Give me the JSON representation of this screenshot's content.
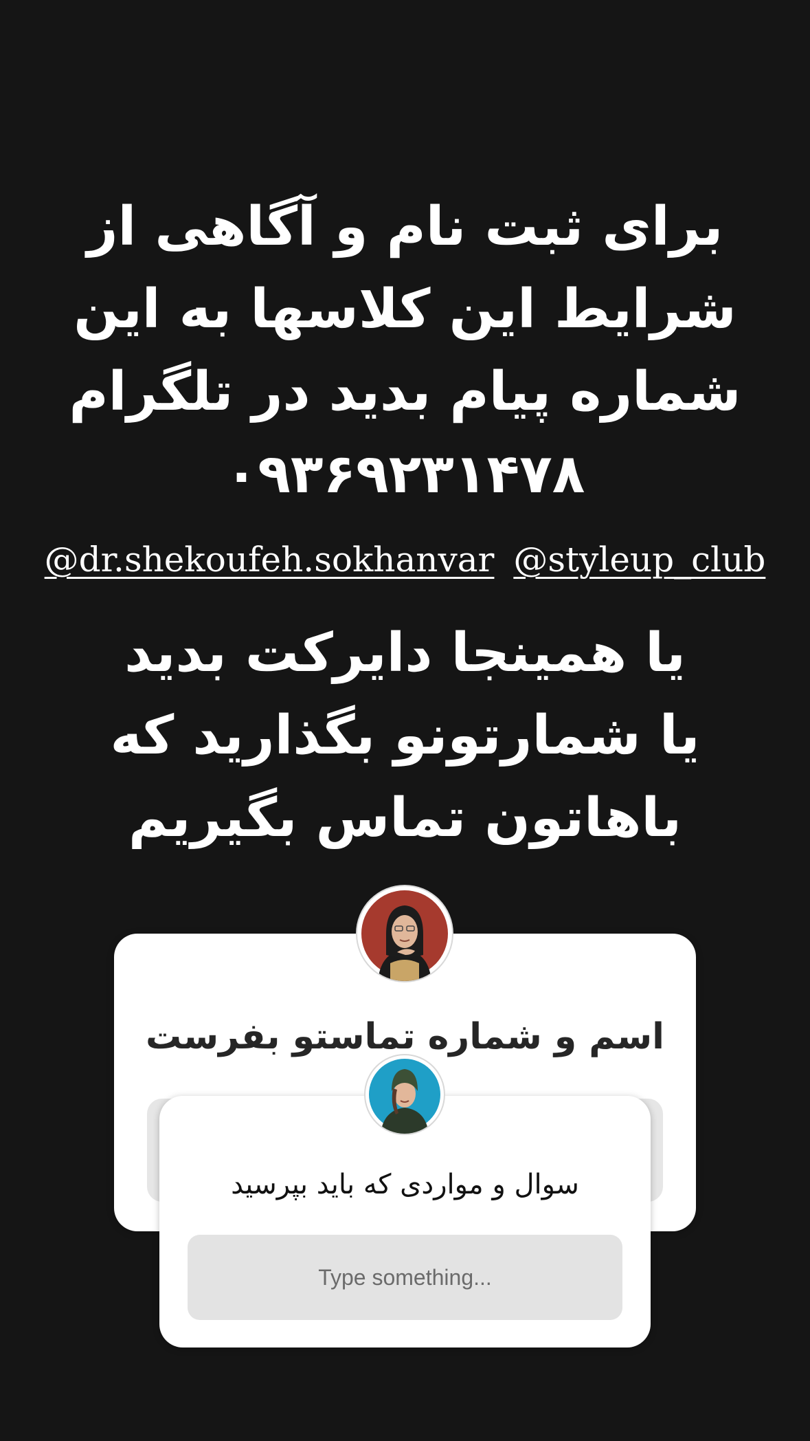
{
  "headline_top": {
    "lines": [
      "برای ثبت نام و آگاهی از",
      "شرایط این کلاسها به این",
      "شماره پیام بدید در تلگرام",
      "۰۹۳۶۹۲۳۱۴۷۸"
    ]
  },
  "mentions": {
    "first": "@dr.shekoufeh.sokhanvar",
    "second": "@styleup_club"
  },
  "headline_bottom": {
    "lines": [
      "یا همینجا دایرکت بدید",
      "یا شمارتونو بگذارید که",
      "باهاتون تماس بگیریم"
    ]
  },
  "question_sticker_back": {
    "question": "اسم و شماره تماستو بفرست",
    "avatar_icon": "profile-avatar-woman-hijab-red-background"
  },
  "question_sticker_front": {
    "question": "سوال و مواردی که باید بپرسید",
    "placeholder": "Type something...",
    "avatar_icon": "profile-avatar-woman-green-hat-blue-background"
  },
  "colors": {
    "background": "#151515",
    "text": "#ffffff",
    "card": "#ffffff",
    "input": "#e3e3e3"
  }
}
